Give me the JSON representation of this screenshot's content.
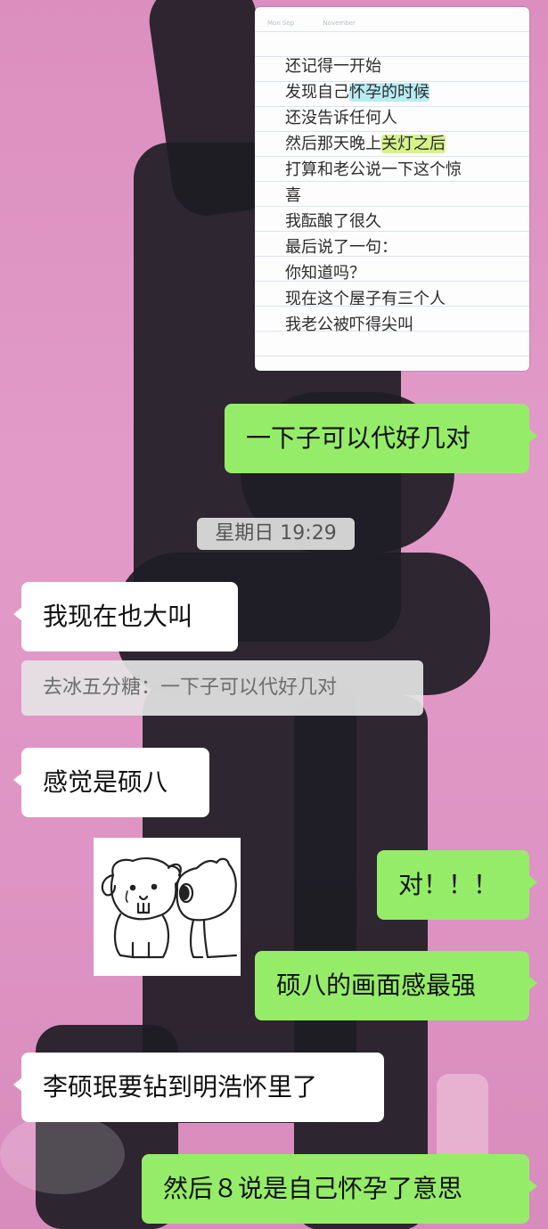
{
  "note": {
    "header": [
      "Mon Sep",
      "November"
    ],
    "lines": [
      {
        "before": "还记得一开始",
        "highlight": "",
        "hl_color": "",
        "after": ""
      },
      {
        "before": "发现自己",
        "highlight": "怀孕的时候",
        "hl_color": "blue",
        "after": ""
      },
      {
        "before": "还没告诉任何人",
        "highlight": "",
        "hl_color": "",
        "after": ""
      },
      {
        "before": "然后那天晚上",
        "highlight": "关灯之后",
        "hl_color": "green",
        "after": ""
      },
      {
        "before": "打算和老公说一下这个惊",
        "highlight": "",
        "hl_color": "",
        "after": ""
      },
      {
        "before": "喜",
        "highlight": "",
        "hl_color": "",
        "after": ""
      },
      {
        "before": "我酝酿了很久",
        "highlight": "",
        "hl_color": "",
        "after": ""
      },
      {
        "before": "最后说了一句：",
        "highlight": "",
        "hl_color": "",
        "after": ""
      },
      {
        "before": "你知道吗？",
        "highlight": "",
        "hl_color": "",
        "after": ""
      },
      {
        "before": "现在这个屋子有三个人",
        "highlight": "",
        "hl_color": "",
        "after": ""
      },
      {
        "before": "我老公被吓得尖叫",
        "highlight": "",
        "hl_color": "",
        "after": ""
      }
    ]
  },
  "messages": {
    "m1": "一下子可以代好几对",
    "timestamp": "星期日 19:29",
    "m2": "我现在也大叫",
    "quote": "去冰五分糖：一下子可以代好几对",
    "m3": "感觉是硕八",
    "m4": "对！！！",
    "m5": "硕八的画面感最强",
    "m6": "李硕珉要钻到明浩怀里了",
    "m7": "然后８说是自己怀孕了意思"
  },
  "colors": {
    "sent_bubble": "#95ec69",
    "received_bubble": "#ffffff",
    "background": "#dc8fbf"
  },
  "sticker": {
    "icon": "two-puppies-sticker"
  }
}
